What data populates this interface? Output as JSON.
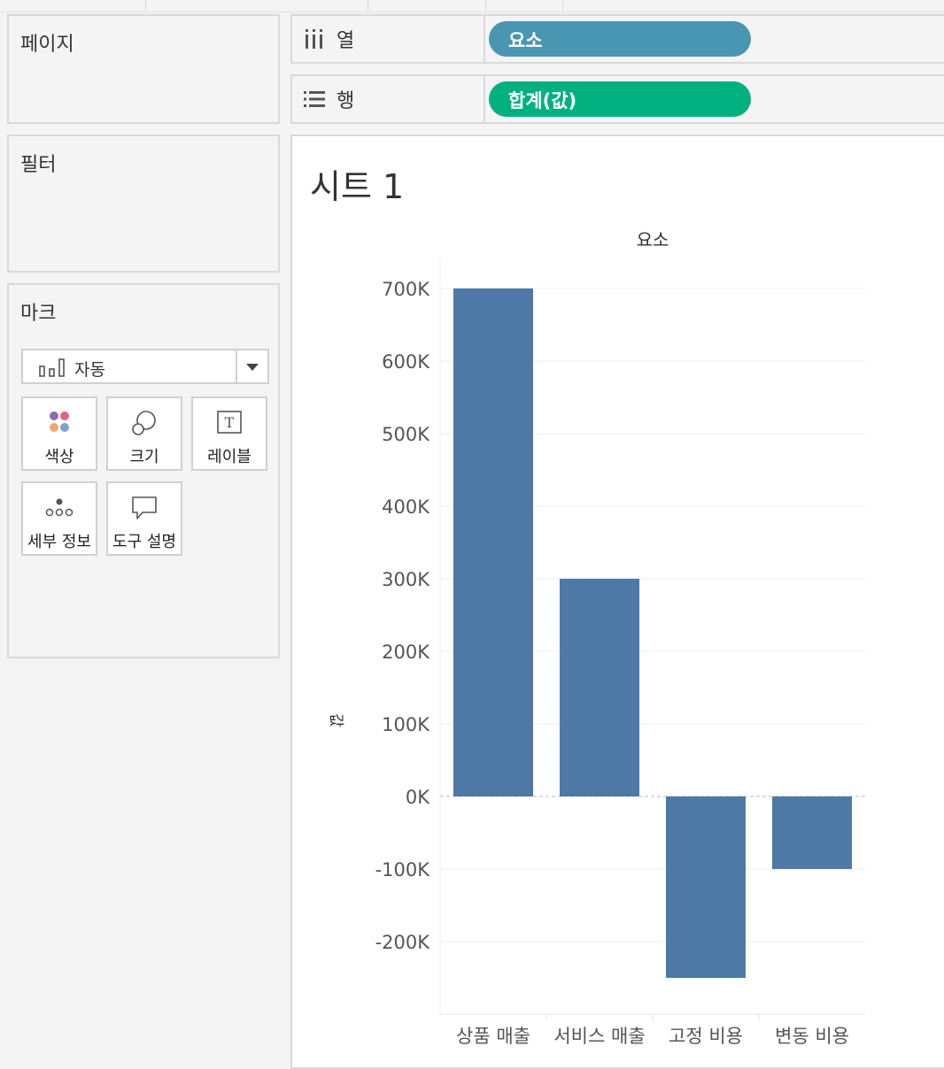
{
  "topstrip_ticks": [
    164,
    415,
    548,
    635
  ],
  "panels": {
    "pages": {
      "title": "페이지"
    },
    "filters": {
      "title": "필터"
    },
    "marks": {
      "title": "마크",
      "mark_type": "자동",
      "buttons": [
        {
          "label": "색상",
          "icon": "color-icon"
        },
        {
          "label": "크기",
          "icon": "size-icon"
        },
        {
          "label": "레이블",
          "icon": "label-icon"
        },
        {
          "label": "세부 정보",
          "icon": "detail-icon"
        },
        {
          "label": "도구 설명",
          "icon": "tooltip-icon"
        }
      ]
    }
  },
  "shelves": {
    "columns": {
      "label": "열",
      "pill": "요소",
      "pill_color": "#4996b2",
      "icon": "columns-icon"
    },
    "rows": {
      "label": "행",
      "pill": "합계(값)",
      "pill_color": "#00b180",
      "icon": "rows-icon"
    }
  },
  "sheet": {
    "title": "시트 1"
  },
  "chart_data": {
    "type": "bar",
    "header": "요소",
    "ylabel": "값",
    "xlabel": "",
    "categories": [
      "상품 매출",
      "서비스 매출",
      "고정 비용",
      "변동 비용"
    ],
    "values": [
      700000,
      300000,
      -250000,
      -100000
    ],
    "ylim": [
      -250000,
      720000
    ],
    "yticks": [
      700000,
      600000,
      500000,
      400000,
      300000,
      200000,
      100000,
      0,
      -100000,
      -200000
    ],
    "ytick_labels": [
      "700K",
      "600K",
      "500K",
      "400K",
      "300K",
      "200K",
      "100K",
      "0K",
      "-100K",
      "-200K"
    ],
    "bar_color": "#4e79a7",
    "grid": true
  }
}
